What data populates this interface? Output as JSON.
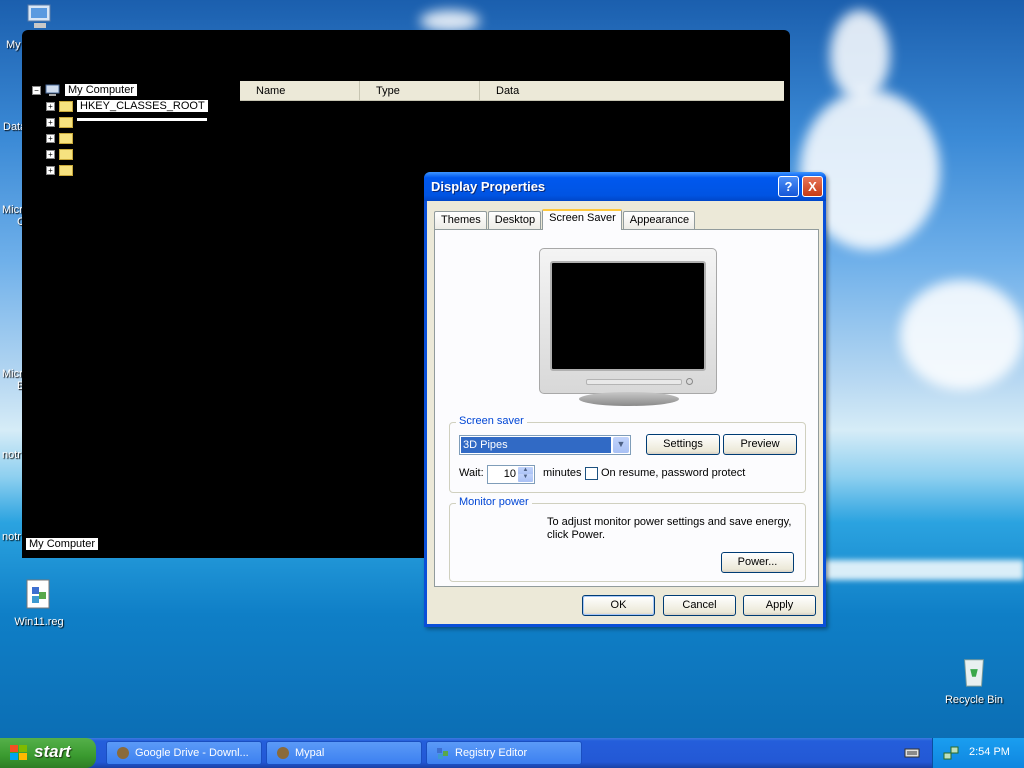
{
  "desktop": {
    "icons": {
      "my_computer_cut": "My",
      "data_cut": "Data",
      "micro1_cut": "Micro",
      "micro1b_cut": "C",
      "micro2_cut": "Micro",
      "micro2b_cut": "B",
      "notr1_cut": "notr",
      "notr2_cut": "notr",
      "win11_reg": "Win11.reg",
      "recycle_bin": "Recycle Bin"
    }
  },
  "regedit": {
    "tree": {
      "root": "My Computer",
      "hkcr": "HKEY_CLASSES_ROOT"
    },
    "columns": [
      "Name",
      "Type",
      "Data"
    ],
    "status": "My Computer"
  },
  "dialog": {
    "title": "Display Properties",
    "help_btn": "?",
    "close_btn": "X",
    "tabs": [
      "Themes",
      "Desktop",
      "Screen Saver",
      "Appearance"
    ],
    "screensaver_group": "Screen saver",
    "screensaver_value": "3D Pipes",
    "settings_btn": "Settings",
    "preview_btn": "Preview",
    "wait_label": "Wait:",
    "wait_value": "10",
    "minutes_label": "minutes",
    "resume_label": "On resume, password protect",
    "monitor_group": "Monitor power",
    "monitor_text": "To adjust monitor power settings and save energy, click Power.",
    "power_btn": "Power...",
    "ok_btn": "OK",
    "cancel_btn": "Cancel",
    "apply_btn": "Apply"
  },
  "taskbar": {
    "start": "start",
    "tasks": [
      "Google Drive - Downl...",
      "Mypal",
      "Registry Editor"
    ],
    "clock": "2:54 PM"
  }
}
